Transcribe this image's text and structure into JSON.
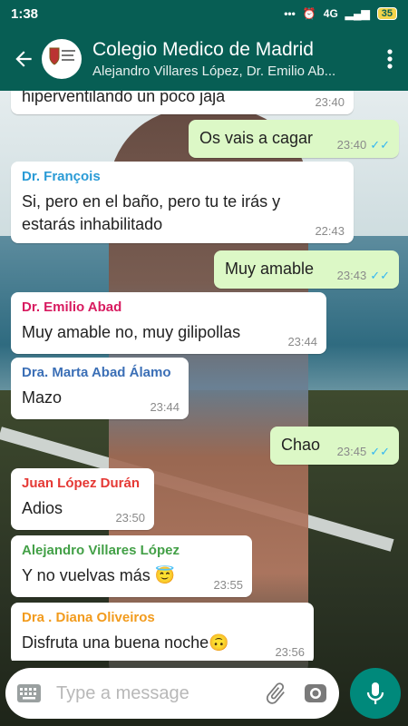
{
  "status_bar": {
    "time": "1:38",
    "network": "4G",
    "battery": "35"
  },
  "header": {
    "title": "Colegio Medico de Madrid",
    "subtitle": "Alejandro Villares López, Dr. Emilio Ab..."
  },
  "messages": [
    {
      "dir": "in",
      "text": "hiperventilando un poco jaja",
      "time": "23:40"
    },
    {
      "dir": "out",
      "text": "Os vais a cagar",
      "time": "23:40",
      "read": true
    },
    {
      "dir": "in",
      "sender": "Dr. François",
      "sender_color": "#2a9bd6",
      "text": "Si, pero en el baño, pero tu te irás y estarás inhabilitado",
      "time": "22:43"
    },
    {
      "dir": "out",
      "text": "Muy amable",
      "time": "23:43",
      "read": true
    },
    {
      "dir": "in",
      "sender": "Dr. Emilio Abad",
      "sender_color": "#d81b60",
      "text": "Muy amable no, muy gilipollas",
      "time": "23:44"
    },
    {
      "dir": "in",
      "sender": "Dra. Marta Abad Álamo",
      "sender_color": "#3b6fb6",
      "text": "Mazo",
      "time": "23:44"
    },
    {
      "dir": "out",
      "text": "Chao",
      "time": "23:45",
      "read": true
    },
    {
      "dir": "in",
      "sender": "Juan López Durán",
      "sender_color": "#e53935",
      "text": "Adios",
      "time": "23:50"
    },
    {
      "dir": "in",
      "sender": "Alejandro Villares López",
      "sender_color": "#43a047",
      "text": "Y no vuelvas más",
      "emoji": "😇",
      "time": "23:55"
    },
    {
      "dir": "in",
      "sender": "Dra . Diana Oliveiros",
      "sender_color": "#f29b1d",
      "text": "Disfruta una buena noche",
      "emoji": "🙃",
      "time": "23:56"
    }
  ],
  "input": {
    "placeholder": "Type a message"
  },
  "icons": {
    "back": "arrow-left-icon",
    "menu": "more-vert-icon",
    "keyboard": "keyboard-icon",
    "attach": "paperclip-icon",
    "camera": "camera-icon",
    "mic": "mic-icon",
    "read": "double-check-icon"
  },
  "colors": {
    "primary": "#075e54",
    "outgoing_bubble": "#dcf8c6",
    "incoming_bubble": "#ffffff",
    "accent": "#00897b",
    "read_ticks": "#34b7f1"
  }
}
